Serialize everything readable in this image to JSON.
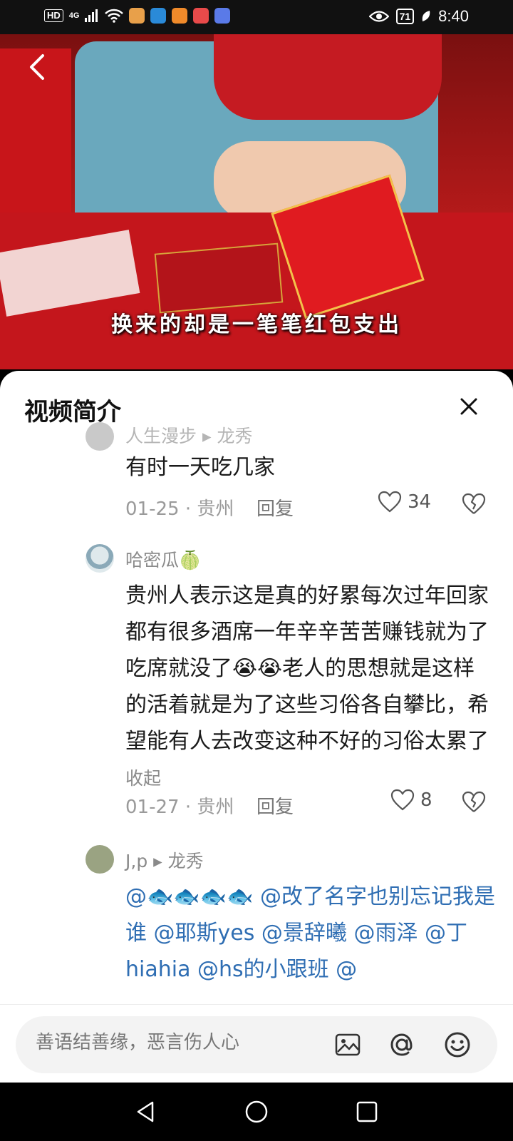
{
  "status_bar": {
    "hd": "HD",
    "network": "4G",
    "battery": "71",
    "time": "8:40"
  },
  "video": {
    "caption": "换来的却是一笔笔红包支出"
  },
  "sheet": {
    "title": "视频简介"
  },
  "comments": [
    {
      "username": "人生漫步 ▸ 龙秀",
      "text": "有时一天吃几家",
      "date_location": "01-25 · 贵州",
      "reply_label": "回复",
      "likes": "34"
    },
    {
      "username": "哈密瓜🍈",
      "text": "贵州人表示这是真的好累每次过年回家都有很多酒席一年辛辛苦苦赚钱就为了吃席就没了😭😭老人的思想就是这样的活着就是为了这些习俗各自攀比，希望能有人去改变这种不好的习俗太累了",
      "collapse_label": "收起",
      "date_location": "01-27 · 贵州",
      "reply_label": "回复",
      "likes": "8"
    },
    {
      "username": "J,p ▸ 龙秀",
      "text": "@🐟🐟🐟🐟 @改了名字也别忘记我是谁 @耶斯yes @景辞曦 @雨泽 @丁hiahia @hs的小跟班 @"
    }
  ],
  "input_bar": {
    "placeholder": "善语结善缘，恶言伤人心"
  },
  "icons": {
    "back": "back-arrow-icon",
    "close": "close-icon",
    "like": "heart-icon",
    "dislike": "broken-heart-icon",
    "image": "image-icon",
    "mention": "at-icon",
    "emoji": "emoji-icon"
  },
  "colors": {
    "mention_blue": "#2f6eb3",
    "meta_gray": "#9a9a9a"
  }
}
